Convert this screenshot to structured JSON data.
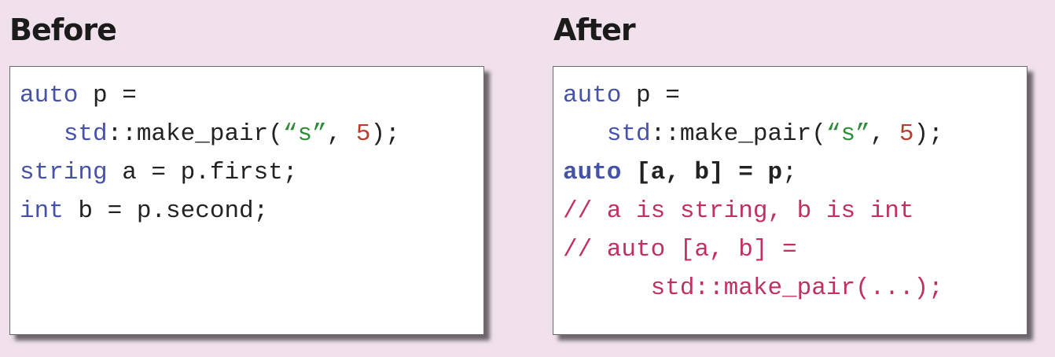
{
  "before": {
    "title": "Before",
    "lines": [
      {
        "indent": "",
        "segments": [
          {
            "t": "auto",
            "k": "kw"
          },
          {
            "t": " p =",
            "k": "p"
          }
        ]
      },
      {
        "indent": "   ",
        "segments": [
          {
            "t": "std",
            "k": "kw"
          },
          {
            "t": "::make_pair(",
            "k": "p"
          },
          {
            "t": "“s”",
            "k": "str"
          },
          {
            "t": ", ",
            "k": "p"
          },
          {
            "t": "5",
            "k": "num"
          },
          {
            "t": ");",
            "k": "p"
          }
        ]
      },
      {
        "indent": "",
        "segments": [
          {
            "t": "string",
            "k": "kw"
          },
          {
            "t": " a = p.first;",
            "k": "p"
          }
        ]
      },
      {
        "indent": "",
        "segments": [
          {
            "t": "int",
            "k": "kw"
          },
          {
            "t": " b = p.second;",
            "k": "p"
          }
        ]
      }
    ]
  },
  "after": {
    "title": "After",
    "lines": [
      {
        "indent": "",
        "segments": [
          {
            "t": "auto",
            "k": "kw"
          },
          {
            "t": " p =",
            "k": "p"
          }
        ]
      },
      {
        "indent": "   ",
        "segments": [
          {
            "t": "std",
            "k": "kw"
          },
          {
            "t": "::make_pair(",
            "k": "p"
          },
          {
            "t": "“s”",
            "k": "str"
          },
          {
            "t": ", ",
            "k": "p"
          },
          {
            "t": "5",
            "k": "num"
          },
          {
            "t": ");",
            "k": "p"
          }
        ]
      },
      {
        "indent": "",
        "segments": [
          {
            "t": "auto",
            "k": "kw bold"
          },
          {
            "t": " [a, b] = p",
            "k": "p bold"
          },
          {
            "t": ";",
            "k": "p"
          }
        ]
      },
      {
        "indent": "",
        "segments": [
          {
            "t": "// a is string, b is int",
            "k": "cm"
          }
        ]
      },
      {
        "indent": "",
        "segments": [
          {
            "t": "// auto [a, b] =",
            "k": "cm"
          }
        ]
      },
      {
        "indent": "      ",
        "segments": [
          {
            "t": "std::make_pair(...);",
            "k": "cm"
          }
        ]
      }
    ]
  },
  "colors": {
    "background": "#f1e1ec",
    "keyword": "#4651a8",
    "string": "#2e8b3a",
    "number": "#b3402e",
    "comment": "#c1305f"
  }
}
